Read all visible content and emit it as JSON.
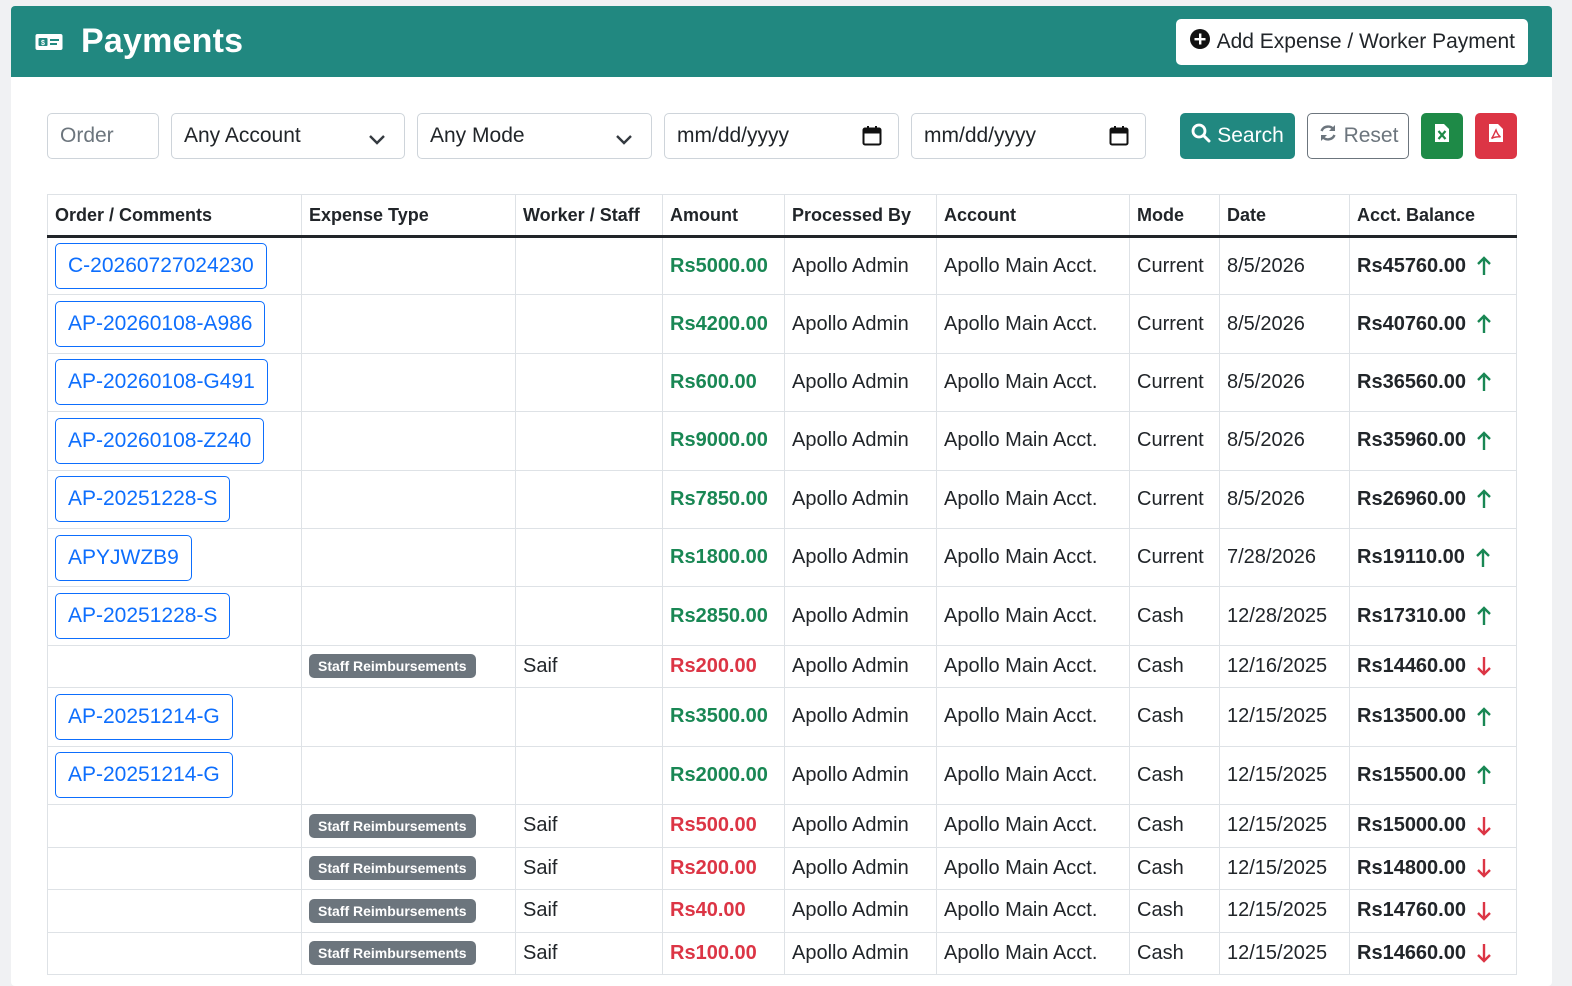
{
  "header": {
    "title": "Payments",
    "add_button_label": "Add Expense / Worker Payment"
  },
  "filters": {
    "order_placeholder": "Order",
    "account_select": "Any Account",
    "mode_select": "Any Mode",
    "date_from_placeholder": "mm/dd/yyyy",
    "date_to_placeholder": "mm/dd/yyyy",
    "search_label": "Search",
    "reset_label": "Reset"
  },
  "table": {
    "columns": [
      "Order / Comments",
      "Expense Type",
      "Worker / Staff",
      "Amount",
      "Processed By",
      "Account",
      "Mode",
      "Date",
      "Acct. Balance"
    ],
    "rows": [
      {
        "order": "C-20260727024230",
        "expense_type": "",
        "worker": "",
        "amount": "Rs5000.00",
        "direction": "in",
        "processed_by": "Apollo Admin",
        "account": "Apollo Main Acct.",
        "mode": "Current",
        "date": "8/5/2026",
        "balance": "Rs45760.00"
      },
      {
        "order": "AP-20260108-A986",
        "expense_type": "",
        "worker": "",
        "amount": "Rs4200.00",
        "direction": "in",
        "processed_by": "Apollo Admin",
        "account": "Apollo Main Acct.",
        "mode": "Current",
        "date": "8/5/2026",
        "balance": "Rs40760.00"
      },
      {
        "order": "AP-20260108-G491",
        "expense_type": "",
        "worker": "",
        "amount": "Rs600.00",
        "direction": "in",
        "processed_by": "Apollo Admin",
        "account": "Apollo Main Acct.",
        "mode": "Current",
        "date": "8/5/2026",
        "balance": "Rs36560.00"
      },
      {
        "order": "AP-20260108-Z240",
        "expense_type": "",
        "worker": "",
        "amount": "Rs9000.00",
        "direction": "in",
        "processed_by": "Apollo Admin",
        "account": "Apollo Main Acct.",
        "mode": "Current",
        "date": "8/5/2026",
        "balance": "Rs35960.00"
      },
      {
        "order": "AP-20251228-S",
        "expense_type": "",
        "worker": "",
        "amount": "Rs7850.00",
        "direction": "in",
        "processed_by": "Apollo Admin",
        "account": "Apollo Main Acct.",
        "mode": "Current",
        "date": "8/5/2026",
        "balance": "Rs26960.00"
      },
      {
        "order": "APYJWZB9",
        "expense_type": "",
        "worker": "",
        "amount": "Rs1800.00",
        "direction": "in",
        "processed_by": "Apollo Admin",
        "account": "Apollo Main Acct.",
        "mode": "Current",
        "date": "7/28/2026",
        "balance": "Rs19110.00"
      },
      {
        "order": "AP-20251228-S",
        "expense_type": "",
        "worker": "",
        "amount": "Rs2850.00",
        "direction": "in",
        "processed_by": "Apollo Admin",
        "account": "Apollo Main Acct.",
        "mode": "Cash",
        "date": "12/28/2025",
        "balance": "Rs17310.00"
      },
      {
        "order": "",
        "expense_type": "Staff Reimbursements",
        "worker": "Saif",
        "amount": "Rs200.00",
        "direction": "out",
        "processed_by": "Apollo Admin",
        "account": "Apollo Main Acct.",
        "mode": "Cash",
        "date": "12/16/2025",
        "balance": "Rs14460.00"
      },
      {
        "order": "AP-20251214-G",
        "expense_type": "",
        "worker": "",
        "amount": "Rs3500.00",
        "direction": "in",
        "processed_by": "Apollo Admin",
        "account": "Apollo Main Acct.",
        "mode": "Cash",
        "date": "12/15/2025",
        "balance": "Rs13500.00"
      },
      {
        "order": "AP-20251214-G",
        "expense_type": "",
        "worker": "",
        "amount": "Rs2000.00",
        "direction": "in",
        "processed_by": "Apollo Admin",
        "account": "Apollo Main Acct.",
        "mode": "Cash",
        "date": "12/15/2025",
        "balance": "Rs15500.00"
      },
      {
        "order": "",
        "expense_type": "Staff Reimbursements",
        "worker": "Saif",
        "amount": "Rs500.00",
        "direction": "out",
        "processed_by": "Apollo Admin",
        "account": "Apollo Main Acct.",
        "mode": "Cash",
        "date": "12/15/2025",
        "balance": "Rs15000.00"
      },
      {
        "order": "",
        "expense_type": "Staff Reimbursements",
        "worker": "Saif",
        "amount": "Rs200.00",
        "direction": "out",
        "processed_by": "Apollo Admin",
        "account": "Apollo Main Acct.",
        "mode": "Cash",
        "date": "12/15/2025",
        "balance": "Rs14800.00"
      },
      {
        "order": "",
        "expense_type": "Staff Reimbursements",
        "worker": "Saif",
        "amount": "Rs40.00",
        "direction": "out",
        "processed_by": "Apollo Admin",
        "account": "Apollo Main Acct.",
        "mode": "Cash",
        "date": "12/15/2025",
        "balance": "Rs14760.00"
      },
      {
        "order": "",
        "expense_type": "Staff Reimbursements",
        "worker": "Saif",
        "amount": "Rs100.00",
        "direction": "out",
        "processed_by": "Apollo Admin",
        "account": "Apollo Main Acct.",
        "mode": "Cash",
        "date": "12/15/2025",
        "balance": "Rs14660.00"
      }
    ]
  },
  "colors": {
    "brand": "#218880",
    "positive": "#198754",
    "negative": "#dc3545",
    "link": "#0d6efd",
    "badge": "#6c757d"
  },
  "icons": {
    "header": "money-bill-icon",
    "add": "plus-circle-icon",
    "search": "search-icon",
    "reset": "refresh-icon",
    "excel": "file-excel-icon",
    "pdf": "file-pdf-icon",
    "in": "arrow-up-icon",
    "out": "arrow-down-icon"
  }
}
